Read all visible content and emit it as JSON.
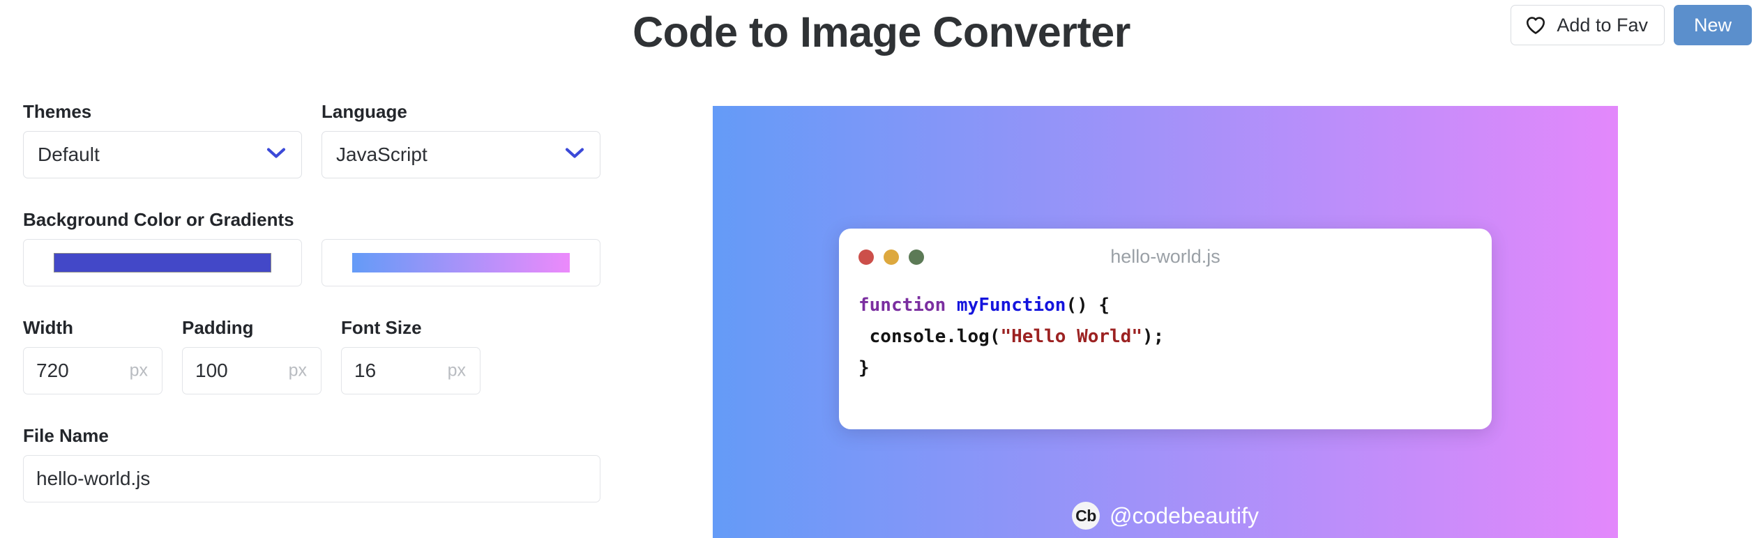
{
  "header": {
    "title": "Code to Image Converter",
    "fav_button_label": "Add to Fav",
    "fav_icon": "heart-icon",
    "new_button_label": "New",
    "new_button_color": "#5b8fcc"
  },
  "settings": {
    "themes": {
      "label": "Themes",
      "value": "Default",
      "chevron_icon": "chevron-down-icon",
      "chevron_color": "#3b49d8"
    },
    "language": {
      "label": "Language",
      "value": "JavaScript",
      "chevron_icon": "chevron-down-icon",
      "chevron_color": "#3b49d8"
    },
    "background": {
      "label": "Background Color or Gradients",
      "solid_color": "#4348c8",
      "gradient_from": "#649bf7",
      "gradient_to": "#ec8afb"
    },
    "width": {
      "label": "Width",
      "value": "720",
      "unit": "px"
    },
    "padding": {
      "label": "Padding",
      "value": "100",
      "unit": "px"
    },
    "font_size": {
      "label": "Font Size",
      "value": "16",
      "unit": "px"
    },
    "file_name": {
      "label": "File Name",
      "value": "hello-world.js"
    }
  },
  "preview": {
    "canvas_gradient_from": "#649bf7",
    "canvas_gradient_to": "#e388fb",
    "card": {
      "filename": "hello-world.js",
      "dots": [
        {
          "name": "close-dot",
          "color": "#cc4f4a"
        },
        {
          "name": "minimize-dot",
          "color": "#dda83e"
        },
        {
          "name": "maximize-dot",
          "color": "#5c7a56"
        }
      ],
      "code_lines": [
        [
          {
            "text": "function ",
            "type": "keyword"
          },
          {
            "text": "myFunction",
            "type": "function"
          },
          {
            "text": "() {",
            "type": "plain"
          }
        ],
        [
          {
            "text": " console.log(",
            "type": "plain"
          },
          {
            "text": "\"Hello World\"",
            "type": "string"
          },
          {
            "text": ");",
            "type": "plain"
          }
        ],
        [
          {
            "text": "}",
            "type": "plain"
          }
        ]
      ]
    },
    "watermark": {
      "logo_text": "Cb",
      "handle": "@codebeautify"
    }
  }
}
